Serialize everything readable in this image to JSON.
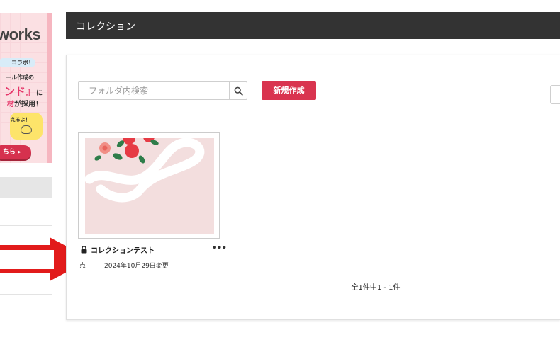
{
  "ad": {
    "brand": "works",
    "collab": "コラボ！",
    "line1": "ール作成の",
    "line2": "ンド』",
    "line2_suffix": "に",
    "line3_prefix": "材",
    "line3_suffix": "が採用！",
    "bubble": "えるよ！",
    "cta": "ちら ▸"
  },
  "header": {
    "title": "コレクション"
  },
  "toolbar": {
    "search_placeholder": "フォルダ内検索",
    "new_label": "新規作成"
  },
  "collection": {
    "title": "コレクションテスト",
    "owner": "点",
    "modified": "2024年10月29日変更",
    "more": "•••"
  },
  "pagination": {
    "text": "全1件中1 - 1件"
  },
  "colors": {
    "header_bg": "#333333",
    "accent": "#d9344f",
    "thumb_bg": "#f3dede",
    "arrow": "#e21b1b"
  },
  "icons": {
    "search": "search-icon",
    "lock": "lock-icon",
    "more": "more-dots-icon"
  }
}
